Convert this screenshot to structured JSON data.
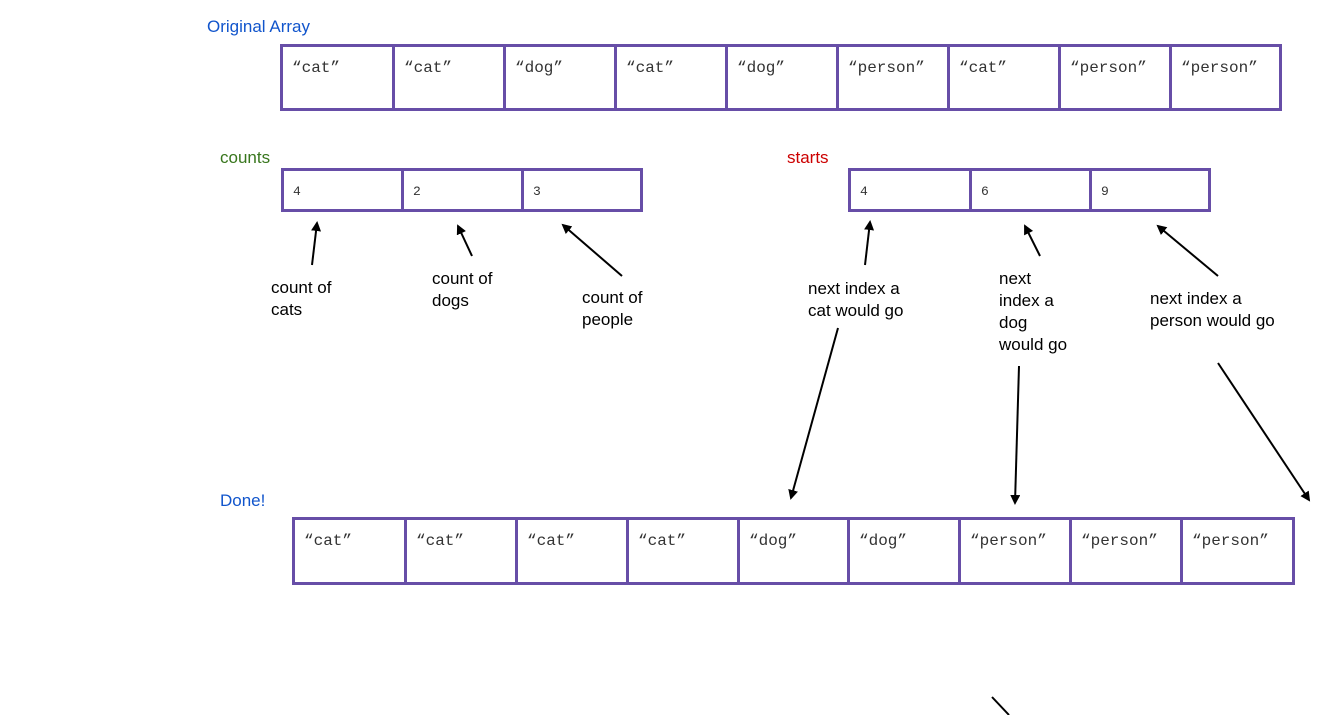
{
  "original": {
    "title": "Original Array",
    "cells": [
      "“cat”",
      "“cat”",
      "“dog”",
      "“cat”",
      "“dog”",
      "“person”",
      "“cat”",
      "“person”",
      "“person”"
    ]
  },
  "counts": {
    "title": "counts",
    "cells": [
      "4",
      "2",
      "3"
    ],
    "notes": [
      "count of\ncats",
      "count of\ndogs",
      "count of\npeople"
    ]
  },
  "starts": {
    "title": "starts",
    "cells": [
      "4",
      "6",
      "9"
    ],
    "notes": [
      "next index a\ncat would go",
      "next\nindex a\ndog\nwould go",
      "next index a\nperson would go"
    ]
  },
  "done": {
    "title": "Done!",
    "cells": [
      "“cat”",
      "“cat”",
      "“cat”",
      "“cat”",
      "“dog”",
      "“dog”",
      "“person”",
      "“person”",
      "“person”"
    ]
  },
  "colors": {
    "border": "#674ea7",
    "title_blue": "#1155cc",
    "counts_green": "#38761d",
    "starts_red": "#cc0000"
  }
}
